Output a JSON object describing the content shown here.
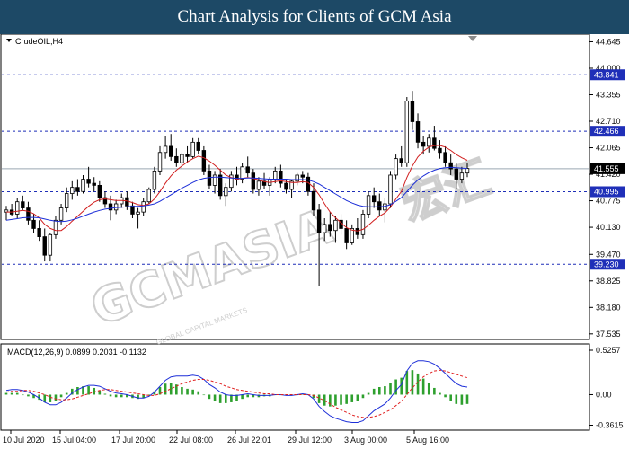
{
  "header": {
    "title": "Chart Analysis for Clients of GCM Asia"
  },
  "watermark": {
    "brand": "GCMASIA",
    "tagline": "GLOBAL CAPITAL MARKETS",
    "chinese": "宏汇"
  },
  "colors": {
    "title_bg": "#1d4966",
    "bull_candle": "#ffffff",
    "bear_candle": "#000000",
    "ma_fast": "#d11e1e",
    "ma_slow": "#1d2fd8",
    "level_line": "#1f2fb8",
    "level_label_bg": "#1f2fb8",
    "price_label_bg": "#000000",
    "macd_line": "#1d2fd8",
    "signal_line": "#e02020",
    "histogram": "#2ea02e"
  },
  "chart_data": [
    {
      "type": "candlestick",
      "symbol_label": "CrudeOIL,H4",
      "ylim": [
        37.4,
        44.83
      ],
      "y_ticks": [
        "44.645",
        "44.000",
        "43.355",
        "42.710",
        "42.065",
        "41.420",
        "40.775",
        "40.130",
        "39.470",
        "38.825",
        "38.180",
        "37.535"
      ],
      "x_ticks": [
        "10 Jul 2020",
        "15 Jul 04:00",
        "17 Jul 20:00",
        "22 Jul 08:00",
        "26 Jul 22:01",
        "29 Jul 12:00",
        "3 Aug 00:00",
        "5 Aug 16:00"
      ],
      "levels": [
        {
          "label": "43.841",
          "value": 43.841
        },
        {
          "label": "42.466",
          "value": 42.466
        },
        {
          "label": "40.995",
          "value": 40.995
        },
        {
          "label": "39.230",
          "value": 39.23
        }
      ],
      "current_price": {
        "label": "41.555",
        "value": 41.555
      },
      "candles": [
        [
          40.5,
          40.65,
          40.3,
          40.55
        ],
        [
          40.55,
          40.7,
          40.4,
          40.45
        ],
        [
          40.45,
          40.85,
          40.35,
          40.75
        ],
        [
          40.75,
          40.9,
          40.55,
          40.6
        ],
        [
          40.6,
          40.75,
          40.2,
          40.3
        ],
        [
          40.3,
          40.45,
          40.0,
          40.1
        ],
        [
          40.1,
          40.3,
          39.8,
          39.9
        ],
        [
          39.9,
          40.1,
          39.3,
          39.45
        ],
        [
          39.45,
          40.0,
          39.3,
          39.95
        ],
        [
          39.95,
          40.4,
          39.85,
          40.3
        ],
        [
          40.3,
          40.7,
          40.2,
          40.6
        ],
        [
          40.6,
          41.1,
          40.5,
          40.95
        ],
        [
          40.95,
          41.25,
          40.8,
          41.1
        ],
        [
          41.1,
          41.3,
          40.9,
          41.0
        ],
        [
          41.0,
          41.4,
          40.95,
          41.3
        ],
        [
          41.3,
          41.6,
          41.1,
          41.2
        ],
        [
          41.2,
          41.35,
          41.0,
          41.15
        ],
        [
          41.15,
          41.25,
          40.75,
          40.85
        ],
        [
          40.85,
          41.0,
          40.6,
          40.7
        ],
        [
          40.7,
          40.9,
          40.3,
          40.55
        ],
        [
          40.55,
          40.8,
          40.45,
          40.7
        ],
        [
          40.7,
          40.95,
          40.6,
          40.85
        ],
        [
          40.85,
          41.0,
          40.55,
          40.65
        ],
        [
          40.65,
          40.75,
          40.35,
          40.45
        ],
        [
          40.45,
          40.6,
          40.1,
          40.5
        ],
        [
          40.5,
          40.85,
          40.4,
          40.75
        ],
        [
          40.75,
          41.1,
          40.7,
          41.05
        ],
        [
          41.05,
          41.6,
          40.95,
          41.5
        ],
        [
          41.5,
          42.1,
          41.4,
          41.95
        ],
        [
          41.95,
          42.35,
          41.8,
          42.1
        ],
        [
          42.1,
          42.4,
          41.75,
          41.85
        ],
        [
          41.85,
          42.05,
          41.6,
          41.7
        ],
        [
          41.7,
          41.95,
          41.55,
          41.9
        ],
        [
          41.9,
          42.1,
          41.7,
          41.85
        ],
        [
          41.85,
          42.3,
          41.8,
          42.2
        ],
        [
          42.2,
          42.3,
          41.9,
          42.0
        ],
        [
          42.0,
          42.1,
          41.4,
          41.5
        ],
        [
          41.5,
          41.65,
          41.05,
          41.15
        ],
        [
          41.15,
          41.5,
          40.95,
          41.4
        ],
        [
          41.4,
          41.55,
          40.8,
          40.9
        ],
        [
          40.9,
          41.2,
          40.65,
          41.1
        ],
        [
          41.1,
          41.5,
          41.0,
          41.4
        ],
        [
          41.4,
          41.6,
          41.15,
          41.3
        ],
        [
          41.3,
          41.7,
          41.2,
          41.6
        ],
        [
          41.6,
          41.85,
          41.35,
          41.45
        ],
        [
          41.45,
          41.55,
          40.95,
          41.05
        ],
        [
          41.05,
          41.35,
          40.9,
          41.25
        ],
        [
          41.25,
          41.45,
          41.05,
          41.15
        ],
        [
          41.15,
          41.35,
          40.9,
          41.3
        ],
        [
          41.3,
          41.6,
          41.2,
          41.5
        ],
        [
          41.5,
          41.65,
          41.1,
          41.2
        ],
        [
          41.2,
          41.3,
          40.95,
          41.05
        ],
        [
          41.05,
          41.3,
          40.85,
          41.25
        ],
        [
          41.25,
          41.45,
          41.15,
          41.4
        ],
        [
          41.4,
          41.5,
          41.2,
          41.35
        ],
        [
          41.35,
          41.45,
          40.9,
          41.0
        ],
        [
          41.0,
          41.2,
          40.4,
          40.55
        ],
        [
          40.55,
          40.7,
          38.7,
          40.0
        ],
        [
          40.0,
          40.35,
          39.8,
          40.2
        ],
        [
          40.2,
          40.5,
          39.9,
          40.05
        ],
        [
          40.05,
          40.4,
          39.75,
          40.3
        ],
        [
          40.3,
          40.45,
          39.95,
          40.1
        ],
        [
          40.1,
          40.3,
          39.6,
          39.75
        ],
        [
          39.75,
          40.2,
          39.7,
          40.1
        ],
        [
          40.1,
          40.35,
          39.85,
          39.95
        ],
        [
          39.95,
          40.55,
          39.85,
          40.45
        ],
        [
          40.45,
          41.0,
          40.35,
          40.9
        ],
        [
          40.9,
          41.1,
          40.6,
          40.75
        ],
        [
          40.75,
          40.95,
          40.4,
          40.55
        ],
        [
          40.55,
          40.85,
          40.25,
          40.7
        ],
        [
          40.7,
          41.5,
          40.6,
          41.4
        ],
        [
          41.4,
          41.9,
          41.3,
          41.8
        ],
        [
          41.8,
          42.1,
          41.6,
          41.7
        ],
        [
          41.7,
          43.3,
          41.6,
          43.2
        ],
        [
          43.2,
          43.45,
          42.5,
          42.7
        ],
        [
          42.7,
          42.9,
          42.05,
          42.2
        ],
        [
          42.2,
          42.35,
          41.9,
          42.1
        ],
        [
          42.1,
          42.4,
          41.95,
          42.3
        ],
        [
          42.3,
          42.6,
          42.0,
          42.05
        ],
        [
          42.05,
          42.25,
          41.8,
          41.95
        ],
        [
          41.95,
          42.1,
          41.6,
          41.7
        ],
        [
          41.7,
          41.9,
          41.4,
          41.55
        ],
        [
          41.55,
          41.7,
          41.05,
          41.3
        ],
        [
          41.3,
          41.6,
          41.2,
          41.45
        ],
        [
          41.45,
          41.7,
          41.35,
          41.56
        ]
      ],
      "ma_fast": [
        40.5,
        40.5,
        40.52,
        40.54,
        40.52,
        40.46,
        40.36,
        40.2,
        40.1,
        40.05,
        40.05,
        40.15,
        40.28,
        40.4,
        40.52,
        40.64,
        40.74,
        40.8,
        40.82,
        40.8,
        40.78,
        40.78,
        40.77,
        40.73,
        40.68,
        40.66,
        40.7,
        40.82,
        41.0,
        41.2,
        41.38,
        41.52,
        41.62,
        41.72,
        41.8,
        41.86,
        41.82,
        41.74,
        41.64,
        41.52,
        41.4,
        41.34,
        41.3,
        41.32,
        41.34,
        41.32,
        41.28,
        41.24,
        41.22,
        41.24,
        41.26,
        41.24,
        41.22,
        41.22,
        41.24,
        41.22,
        41.1,
        40.92,
        40.7,
        40.5,
        40.36,
        40.24,
        40.12,
        40.06,
        40.04,
        40.08,
        40.18,
        40.3,
        40.4,
        40.48,
        40.62,
        40.82,
        41.0,
        41.34,
        41.62,
        41.84,
        41.98,
        42.08,
        42.12,
        42.12,
        42.08,
        42.0,
        41.9,
        41.82,
        41.76
      ],
      "ma_slow": [
        40.3,
        40.32,
        40.34,
        40.36,
        40.37,
        40.37,
        40.36,
        40.33,
        40.3,
        40.28,
        40.27,
        40.28,
        40.31,
        40.35,
        40.4,
        40.45,
        40.5,
        40.54,
        40.57,
        40.59,
        40.61,
        40.62,
        40.63,
        40.64,
        40.64,
        40.65,
        40.67,
        40.7,
        40.76,
        40.84,
        40.92,
        41.0,
        41.08,
        41.15,
        41.22,
        41.28,
        41.32,
        41.34,
        41.35,
        41.35,
        41.34,
        41.33,
        41.32,
        41.32,
        41.33,
        41.33,
        41.32,
        41.31,
        41.3,
        41.3,
        41.3,
        41.3,
        41.29,
        41.29,
        41.29,
        41.28,
        41.24,
        41.18,
        41.1,
        41.02,
        40.94,
        40.86,
        40.78,
        40.72,
        40.67,
        40.64,
        40.63,
        40.63,
        40.63,
        40.64,
        40.68,
        40.76,
        40.85,
        41.0,
        41.15,
        41.28,
        41.38,
        41.46,
        41.52,
        41.56,
        41.58,
        41.59,
        41.58,
        41.57,
        41.56
      ]
    },
    {
      "type": "macd",
      "label": "MACD(12,26,9) 0.0899 0.2031 -0.1132",
      "ylim": [
        -0.42,
        0.6
      ],
      "y_ticks": [
        "0.5257",
        "0.00",
        "-0.3615"
      ],
      "macd": [
        0.05,
        0.06,
        0.06,
        0.05,
        0.03,
        0.0,
        -0.04,
        -0.09,
        -0.12,
        -0.12,
        -0.09,
        -0.04,
        0.02,
        0.06,
        0.09,
        0.11,
        0.11,
        0.1,
        0.07,
        0.04,
        0.02,
        0.01,
        0.0,
        -0.02,
        -0.04,
        -0.04,
        -0.02,
        0.03,
        0.1,
        0.17,
        0.21,
        0.22,
        0.22,
        0.22,
        0.23,
        0.22,
        0.18,
        0.12,
        0.08,
        0.03,
        0.0,
        -0.01,
        -0.01,
        0.0,
        0.01,
        0.0,
        -0.01,
        -0.01,
        -0.01,
        0.0,
        0.0,
        -0.01,
        -0.01,
        0.0,
        0.01,
        0.0,
        -0.05,
        -0.14,
        -0.2,
        -0.25,
        -0.28,
        -0.3,
        -0.32,
        -0.33,
        -0.33,
        -0.31,
        -0.25,
        -0.19,
        -0.15,
        -0.11,
        -0.04,
        0.05,
        0.12,
        0.28,
        0.37,
        0.4,
        0.4,
        0.39,
        0.36,
        0.31,
        0.25,
        0.19,
        0.13,
        0.1,
        0.09
      ],
      "signal": [
        0.03,
        0.04,
        0.04,
        0.05,
        0.05,
        0.04,
        0.02,
        0.0,
        -0.03,
        -0.05,
        -0.06,
        -0.06,
        -0.05,
        -0.03,
        -0.01,
        0.01,
        0.03,
        0.05,
        0.06,
        0.06,
        0.05,
        0.04,
        0.03,
        0.02,
        0.01,
        0.0,
        -0.01,
        -0.01,
        0.01,
        0.04,
        0.07,
        0.1,
        0.13,
        0.15,
        0.17,
        0.18,
        0.18,
        0.17,
        0.15,
        0.13,
        0.1,
        0.08,
        0.06,
        0.05,
        0.04,
        0.03,
        0.02,
        0.01,
        0.01,
        0.0,
        0.0,
        0.0,
        0.0,
        0.0,
        0.0,
        0.0,
        -0.01,
        -0.04,
        -0.07,
        -0.11,
        -0.15,
        -0.18,
        -0.21,
        -0.24,
        -0.26,
        -0.27,
        -0.27,
        -0.26,
        -0.24,
        -0.21,
        -0.18,
        -0.13,
        -0.08,
        0.0,
        0.08,
        0.15,
        0.21,
        0.25,
        0.28,
        0.29,
        0.28,
        0.26,
        0.24,
        0.22,
        0.2
      ]
    }
  ]
}
